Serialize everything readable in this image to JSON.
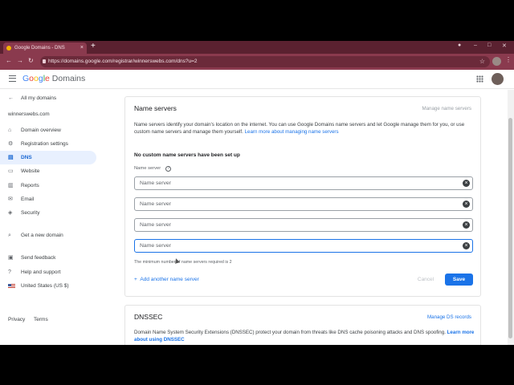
{
  "browser": {
    "tab_title": "Google Domains - DNS",
    "tab_close": "×",
    "new_tab": "+",
    "url": "https://domains.google.com/registrar/winnerswebs.com/dns?u=2",
    "win_min": "–",
    "win_max": "□",
    "win_close": "✕"
  },
  "header": {
    "logo_google": "Google",
    "logo_domains": " Domains",
    "logo_colors": [
      "#4285f4",
      "#ea4335",
      "#fbbc05",
      "#4285f4",
      "#34a853",
      "#ea4335"
    ]
  },
  "sidebar": {
    "back_label": "All my domains",
    "domain": "winnerswebs.com",
    "items": [
      {
        "label": "Domain overview",
        "icon": "home-icon"
      },
      {
        "label": "Registration settings",
        "icon": "gear-icon"
      },
      {
        "label": "DNS",
        "icon": "dns-icon",
        "active": true
      },
      {
        "label": "Website",
        "icon": "website-icon"
      },
      {
        "label": "Reports",
        "icon": "reports-icon"
      },
      {
        "label": "Email",
        "icon": "email-icon"
      },
      {
        "label": "Security",
        "icon": "shield-icon"
      }
    ],
    "get_new_domain": "Get a new domain",
    "send_feedback": "Send feedback",
    "help_support": "Help and support",
    "locale": "United States (US $)",
    "privacy": "Privacy",
    "terms": "Terms"
  },
  "name_servers": {
    "title": "Name servers",
    "manage_link": "Manage name servers",
    "description": "Name servers identify your domain's location on the internet. You can use Google Domains name servers and let Google manage them for you, or use custom name servers and manage them yourself.",
    "learn_more": "Learn more about managing name servers",
    "no_custom": "No custom name servers have been set up",
    "field_label": "Name server",
    "placeholders": [
      "Name server",
      "Name server",
      "Name server",
      "Name server"
    ],
    "hint": "The minimum number of name servers required is 2",
    "add_another": "Add another name server",
    "cancel": "Cancel",
    "save": "Save"
  },
  "dnssec": {
    "title": "DNSSEC",
    "manage_link": "Manage DS records",
    "description": "Domain Name System Security Extensions (DNSSEC) protect your domain from threats like DNS cache poisoning attacks and DNS spoofing.",
    "learn_more": "Learn more about using DNSSEC"
  }
}
